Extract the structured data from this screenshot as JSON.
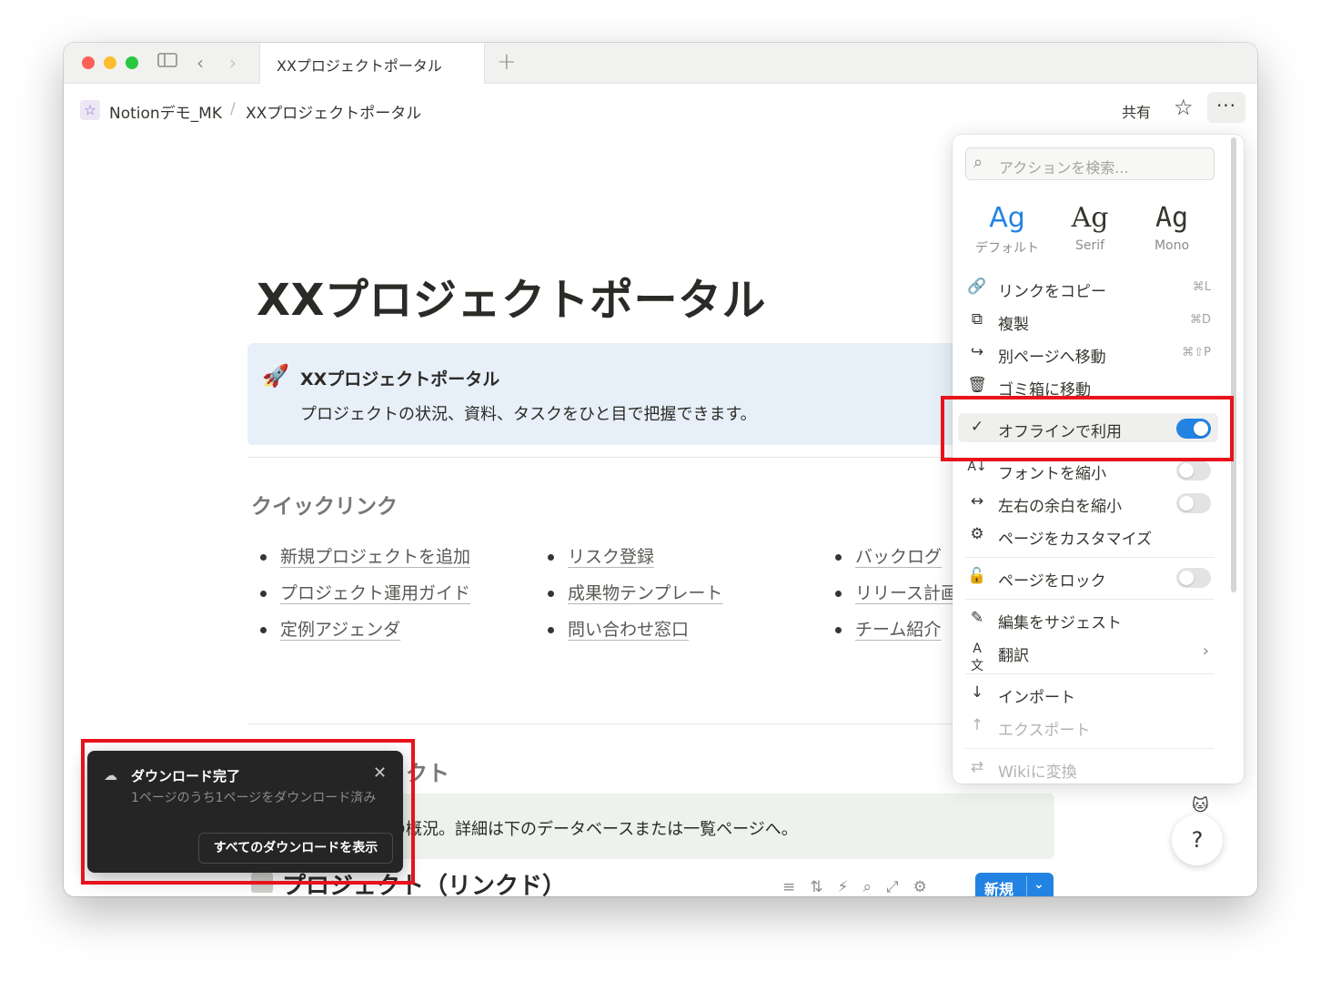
{
  "tab": {
    "title": "XXプロジェクトポータル"
  },
  "breadcrumb": {
    "workspace": "Notionデモ_MK",
    "separator": "/",
    "page": "XXプロジェクトポータル"
  },
  "topbar": {
    "share_label": "共有"
  },
  "page": {
    "title": "XXプロジェクトポータル",
    "callout": {
      "icon": "🚀",
      "title": "XXプロジェクトポータル",
      "description": "プロジェクトの状況、資料、タスクをひと目で把握できます。"
    },
    "quicklinks_heading": "クイックリンク",
    "links_col1": [
      "新規プロジェクトを追加",
      "プロジェクト運用ガイド",
      "定例アジェンダ"
    ],
    "links_col2": [
      "リスク登録",
      "成果物テンプレート",
      "問い合わせ窓口"
    ],
    "links_col3": [
      "バックログ",
      "リリース計画",
      "チーム紹介"
    ],
    "section2_heading_partial": "クト",
    "callout2_text": "クトの概況。詳細は下のデータベースまたは一覧ページへ。",
    "db_heading": "プロジェクト（リンクド）",
    "db_new_button": "新規"
  },
  "toast": {
    "title": "ダウンロード完了",
    "message": "1ページのうち1ページをダウンロード済み",
    "button": "すべてのダウンロードを表示"
  },
  "menu": {
    "search_placeholder": "アクションを検索...",
    "fonts": [
      {
        "sample": "Ag",
        "label": "デフォルト",
        "selected": true
      },
      {
        "sample": "Ag",
        "label": "Serif",
        "selected": false
      },
      {
        "sample": "Ag",
        "label": "Mono",
        "selected": false
      }
    ],
    "items": {
      "copy_link": {
        "label": "リンクをコピー",
        "shortcut": "⌘L"
      },
      "duplicate": {
        "label": "複製",
        "shortcut": "⌘D"
      },
      "move_to": {
        "label": "別ページへ移動",
        "shortcut": "⌘⇧P"
      },
      "trash": {
        "label": "ゴミ箱に移動"
      },
      "offline": {
        "label": "オフラインで利用",
        "toggle": true
      },
      "small_text": {
        "label": "フォントを縮小",
        "toggle": false
      },
      "full_width": {
        "label": "左右の余白を縮小",
        "toggle": false
      },
      "customize": {
        "label": "ページをカスタマイズ"
      },
      "lock": {
        "label": "ページをロック",
        "toggle": false
      },
      "suggest": {
        "label": "編集をサジェスト"
      },
      "translate": {
        "label": "翻訳"
      },
      "import": {
        "label": "インポート"
      },
      "export": {
        "label": "エクスポート"
      },
      "wiki": {
        "label": "Wikiに変換"
      }
    }
  },
  "colors": {
    "accent": "#2383e2",
    "highlight_box": "#e8121b",
    "toast_bg": "#252525"
  }
}
